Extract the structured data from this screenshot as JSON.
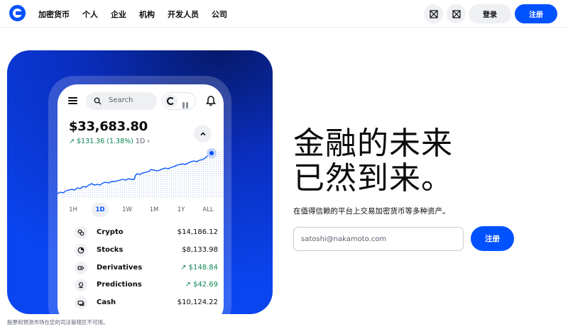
{
  "nav": {
    "links": [
      "加密货币",
      "个人",
      "企业",
      "机构",
      "开发人员",
      "公司"
    ],
    "icon_1": "search-icon",
    "icon_2": "globe-icon",
    "login_label": "登录",
    "signup_label": "注册"
  },
  "phone": {
    "search_placeholder": "Search",
    "balance": "$33,683.80",
    "change": "↗ $131.36 (1.38%)",
    "change_range": "1D",
    "ranges": [
      "1H",
      "1D",
      "1W",
      "1M",
      "1Y",
      "ALL"
    ],
    "active_range": "1D",
    "assets": [
      {
        "name": "Crypto",
        "value": "$14,186.12",
        "trend": "neutral",
        "icon": "coins-icon"
      },
      {
        "name": "Stocks",
        "value": "$8,133.98",
        "trend": "neutral",
        "icon": "pie-chart-icon"
      },
      {
        "name": "Derivatives",
        "value": "↗ $148.84",
        "trend": "up",
        "icon": "derivatives-icon"
      },
      {
        "name": "Predictions",
        "value": "↗ $42.69",
        "trend": "up",
        "icon": "predictions-icon"
      },
      {
        "name": "Cash",
        "value": "$10,124.22",
        "trend": "neutral",
        "icon": "cash-icon"
      }
    ]
  },
  "hero": {
    "headline_line1": "金融的未来",
    "headline_line2": "已然到来。",
    "subline": "在值得信赖的平台上交易加密货币等多种资产。",
    "email_placeholder": "satoshi@nakamoto.com",
    "signup_label": "注册"
  },
  "footnote": "股票和预测市场在您的司法管辖区不可用。",
  "colors": {
    "brand_blue": "#0052ff",
    "positive_green": "#098551"
  }
}
